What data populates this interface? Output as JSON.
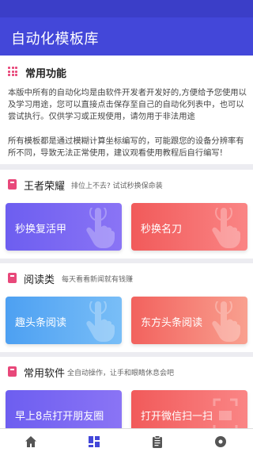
{
  "app": {
    "title": "自动化模板库"
  },
  "notice": {
    "heading": "常用功能",
    "paragraph1": "本版中所有的自动化均是由软件开发者开发好的,方便给予您使用以及学习用途，您可以直接点击保存至自己的自动化列表中，也可以尝试执行。仅供学习或正规使用，请勿用于非法用途",
    "paragraph2": "所有模板都是通过模糊计算坐标编写的，可能跟您的设备分辨率有所不同，导致无法正常使用，建议观看使用教程后自行编写!"
  },
  "sections": [
    {
      "title": "王者荣耀",
      "subtitle": "排位上不去? 试试秒换保命装",
      "tiles": [
        {
          "label": "秒换复活甲",
          "color": "purple"
        },
        {
          "label": "秒换名刀",
          "color": "red"
        }
      ]
    },
    {
      "title": "阅读类",
      "subtitle": "每天看看新闻就有钱赚",
      "tiles": [
        {
          "label": "趣头条阅读",
          "color": "blue"
        },
        {
          "label": "东方头条阅读",
          "color": "orange"
        }
      ]
    },
    {
      "title": "常用软件",
      "subtitle": "全自动操作，让手和眼睛休息会吧",
      "tiles": [
        {
          "label": "早上8点打开朋友圈",
          "color": "purple"
        },
        {
          "label": "打开微信扫一扫",
          "color": "red"
        }
      ]
    }
  ],
  "bottom_nav": {
    "items": [
      {
        "icon": "home-icon",
        "active": false
      },
      {
        "icon": "grid-icon",
        "active": true
      },
      {
        "icon": "clipboard-icon",
        "active": false
      },
      {
        "icon": "settings-icon",
        "active": false
      }
    ]
  },
  "colors": {
    "primary": "#4347d9",
    "accent_pink": "#e8487a",
    "tile_purple": "#6d5ef0",
    "tile_red": "#f15a5a",
    "tile_blue": "#4da0f2",
    "tile_orange": "#f2625e"
  }
}
